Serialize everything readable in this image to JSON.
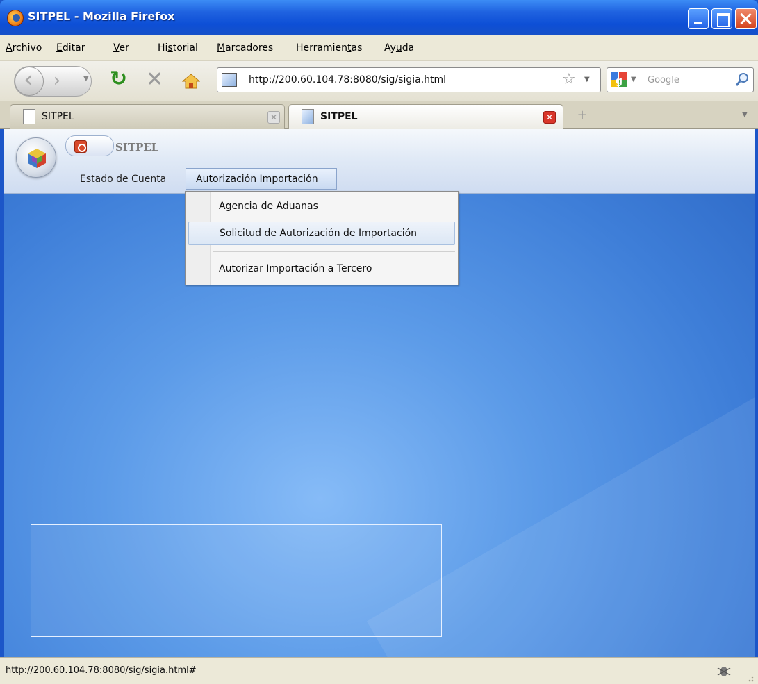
{
  "window": {
    "title": "SITPEL - Mozilla Firefox"
  },
  "menubar": {
    "items": [
      {
        "pre": "",
        "ul": "A",
        "post": "rchivo"
      },
      {
        "pre": "",
        "ul": "E",
        "post": "ditar"
      },
      {
        "pre": "",
        "ul": "V",
        "post": "er"
      },
      {
        "pre": "Hi",
        "ul": "s",
        "post": "torial"
      },
      {
        "pre": "",
        "ul": "M",
        "post": "arcadores"
      },
      {
        "pre": "Herramien",
        "ul": "t",
        "post": "as"
      },
      {
        "pre": "Ay",
        "ul": "u",
        "post": "da"
      }
    ]
  },
  "navbar": {
    "url": "http://200.60.104.78:8080/sig/sigia.html",
    "search_placeholder": "Google"
  },
  "tabs": [
    {
      "label": "SITPEL",
      "active": false
    },
    {
      "label": "SITPEL",
      "active": true
    }
  ],
  "app": {
    "name": "SITPEL",
    "nav": [
      "Estado de Cuenta",
      "Autorización Importación"
    ],
    "dropdown": [
      "Agencia de Aduanas",
      "Solicitud de Autorización de Importación",
      "Autorizar Importación a Tercero"
    ]
  },
  "statusbar": {
    "text": "http://200.60.104.78:8080/sig/sigia.html#"
  },
  "colors": {
    "titlebar": "#1f62e0",
    "chrome": "#ece9d8",
    "desktop": "#5c9be8",
    "tab_close_active": "#d9362a"
  }
}
